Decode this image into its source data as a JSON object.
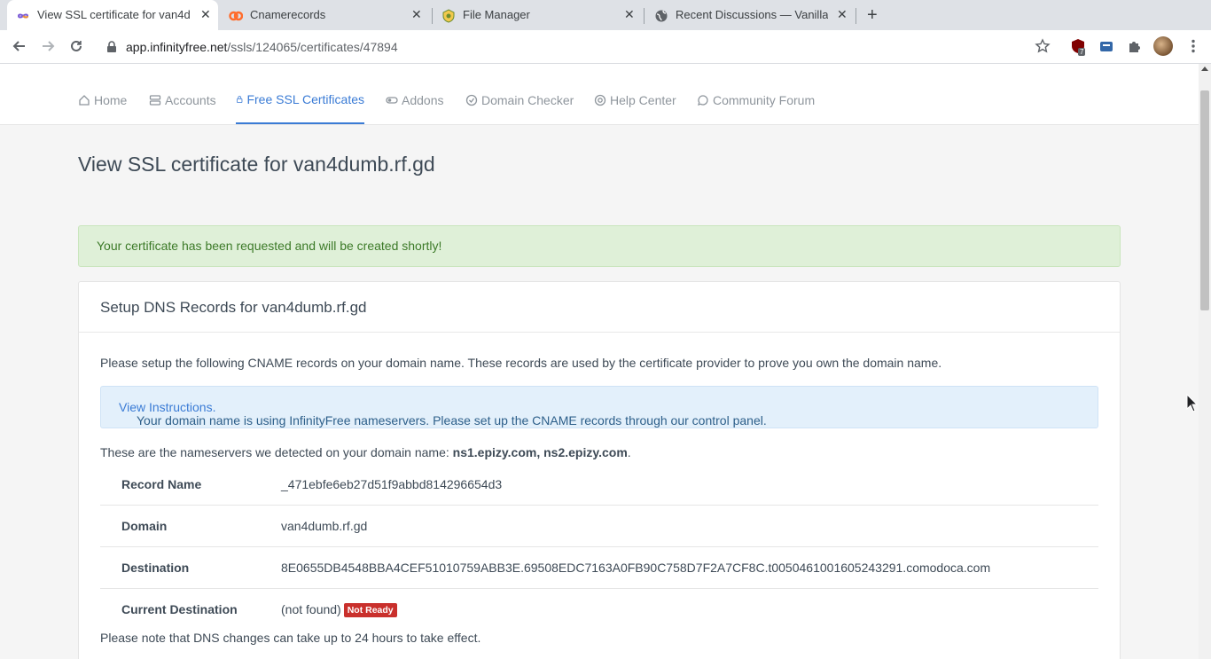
{
  "browser": {
    "tabs": [
      {
        "title": "View SSL certificate for van4d",
        "icon": "infinityfree-icon"
      },
      {
        "title": "Cnamerecords",
        "icon": "cpanel-icon"
      },
      {
        "title": "File Manager",
        "icon": "filemanager-icon"
      },
      {
        "title": "Recent Discussions — Vanilla",
        "icon": "globe-icon"
      }
    ],
    "url_host": "app.infinityfree.net",
    "url_path": "/ssls/124065/certificates/47894",
    "extension_badge": "7"
  },
  "nav": {
    "items": [
      {
        "label": "Home",
        "icon": "home-icon"
      },
      {
        "label": "Accounts",
        "icon": "server-icon"
      },
      {
        "label": "Free SSL Certificates",
        "icon": "lock-icon"
      },
      {
        "label": "Addons",
        "icon": "toggle-icon"
      },
      {
        "label": "Domain Checker",
        "icon": "check-circle-icon"
      },
      {
        "label": "Help Center",
        "icon": "lifebuoy-icon"
      },
      {
        "label": "Community Forum",
        "icon": "chat-icon"
      }
    ],
    "active": "Free SSL Certificates"
  },
  "page": {
    "title": "View SSL certificate for van4dumb.rf.gd",
    "success_message": "Your certificate has been requested and will be created shortly!",
    "card_title": "Setup DNS Records for van4dumb.rf.gd",
    "instructions": "Please setup the following CNAME records on your domain name. These records are used by the certificate provider to prove you own the domain name.",
    "info_message": "Your domain name is using InfinityFree nameservers. Please set up the CNAME records through our control panel.",
    "info_link": "View Instructions.",
    "nameservers_prefix": "These are the nameservers we detected on your domain name:",
    "nameservers": "ns1.epizy.com, ns2.epizy.com",
    "nameservers_suffix": ".",
    "records": [
      {
        "key": "Record Name",
        "value": "_471ebfe6eb27d51f9abbd814296654d3"
      },
      {
        "key": "Domain",
        "value": "van4dumb.rf.gd"
      },
      {
        "key": "Destination",
        "value": "8E0655DB4548BBA4CEF51010759ABB3E.69508EDC7163A0FB90C758D7F2A7CF8C.t0050461001605243291.comodoca.com"
      },
      {
        "key": "Current Destination",
        "value": "(not found)"
      }
    ],
    "status_badge": "Not Ready",
    "note": "Please note that DNS changes can take up to 24 hours to take effect."
  },
  "colors": {
    "accent": "#3a7bd5",
    "success_bg": "#dff0d8",
    "info_bg": "#e3f0fb",
    "danger": "#c9302c"
  }
}
